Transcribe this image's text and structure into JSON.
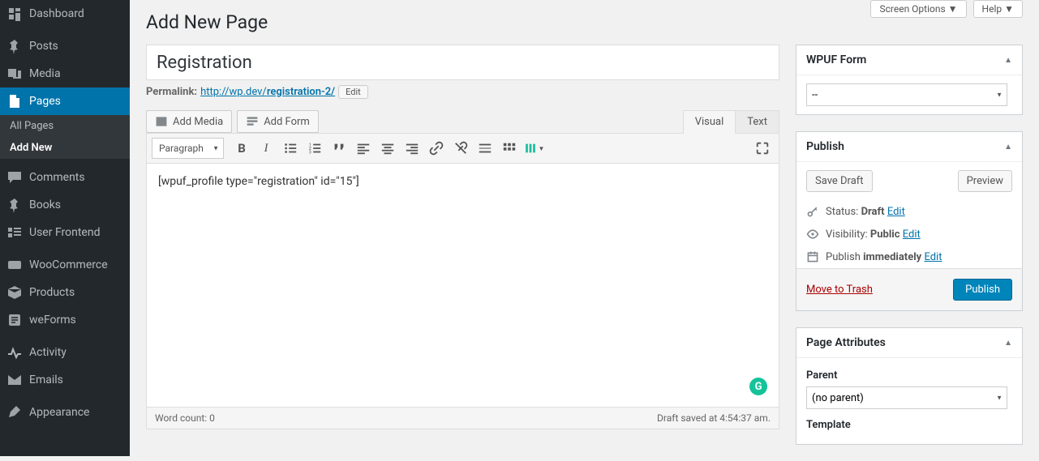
{
  "sidebar": {
    "items": [
      {
        "label": "Dashboard",
        "icon": "dashboard"
      },
      {
        "label": "Posts",
        "icon": "pin"
      },
      {
        "label": "Media",
        "icon": "media"
      },
      {
        "label": "Pages",
        "icon": "page",
        "current": true
      },
      {
        "label": "Comments",
        "icon": "comment"
      },
      {
        "label": "Books",
        "icon": "pin"
      },
      {
        "label": "User Frontend",
        "icon": "uf"
      },
      {
        "label": "WooCommerce",
        "icon": "woo"
      },
      {
        "label": "Products",
        "icon": "box"
      },
      {
        "label": "weForms",
        "icon": "form"
      },
      {
        "label": "Activity",
        "icon": "activity"
      },
      {
        "label": "Emails",
        "icon": "mail"
      },
      {
        "label": "Appearance",
        "icon": "appearance"
      }
    ],
    "submenu": [
      {
        "label": "All Pages"
      },
      {
        "label": "Add New",
        "current": true
      }
    ]
  },
  "topbar": {
    "screen_options": "Screen Options",
    "help": "Help"
  },
  "page": {
    "heading": "Add New Page"
  },
  "title": {
    "value": "Registration"
  },
  "permalink": {
    "label": "Permalink:",
    "base": "http://wp.dev/",
    "slug": "registration-2/",
    "edit": "Edit"
  },
  "buttons": {
    "add_media": "Add Media",
    "add_form": "Add Form"
  },
  "editor": {
    "tabs": {
      "visual": "Visual",
      "text": "Text"
    },
    "format_select": "Paragraph",
    "content": "[wpuf_profile type=\"registration\" id=\"15\"]",
    "word_count": "Word count: 0",
    "saved": "Draft saved at 4:54:37 am."
  },
  "wpuf": {
    "heading": "WPUF Form",
    "value": "--"
  },
  "publish": {
    "heading": "Publish",
    "save_draft": "Save Draft",
    "preview": "Preview",
    "status_label": "Status:",
    "status_value": "Draft",
    "visibility_label": "Visibility:",
    "visibility_value": "Public",
    "schedule_label": "Publish",
    "schedule_value": "immediately",
    "edit": "Edit",
    "trash": "Move to Trash",
    "publish_btn": "Publish"
  },
  "page_attr": {
    "heading": "Page Attributes",
    "parent_label": "Parent",
    "parent_value": "(no parent)",
    "template_label": "Template"
  }
}
